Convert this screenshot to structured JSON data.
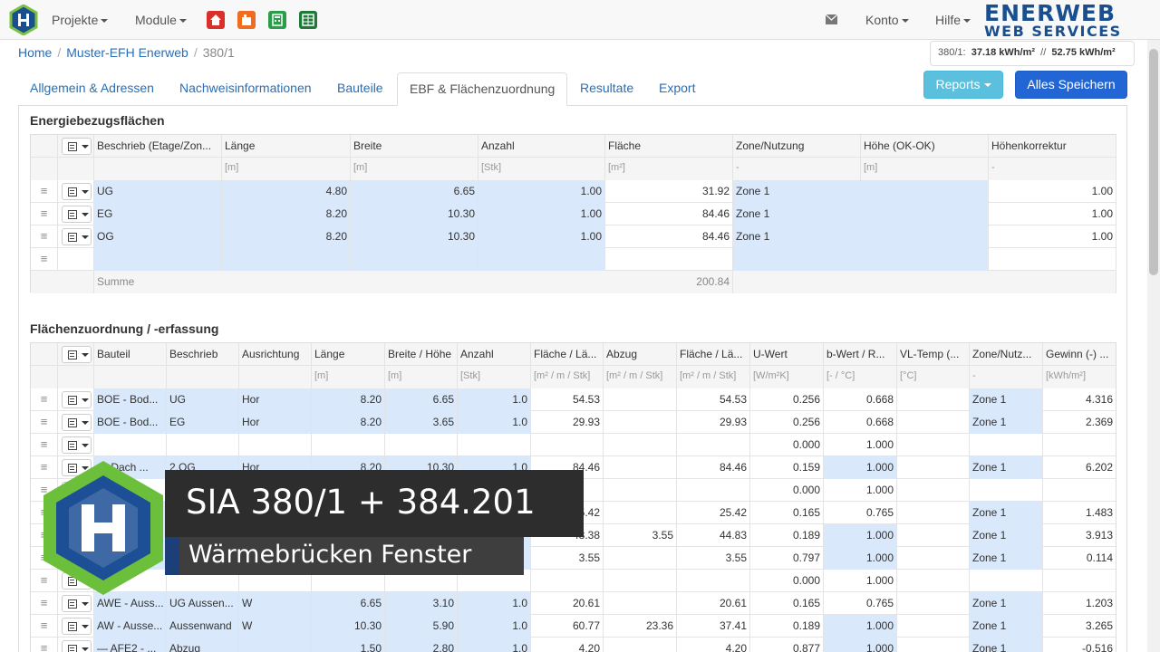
{
  "nav": {
    "projects": "Projekte",
    "modules": "Module",
    "account": "Konto",
    "help": "Hilfe"
  },
  "brand": {
    "line1": "ENERWEB",
    "line2": "WEB SERVICES"
  },
  "breadcrumb": {
    "home": "Home",
    "project": "Muster-EFH Enerweb",
    "current": "380/1"
  },
  "energy": {
    "label": "380/1:",
    "v1": "37.18 kWh/m²",
    "sep": "//",
    "v2": "52.75 kWh/m²"
  },
  "tabs": [
    "Allgemein & Adressen",
    "Nachweisinformationen",
    "Bauteile",
    "EBF & Flächenzuordnung",
    "Resultate",
    "Export"
  ],
  "buttons": {
    "reports": "Reports",
    "save": "Alles Speichern"
  },
  "ebf": {
    "title": "Energiebezugsflächen",
    "headers": [
      "Beschrieb (Etage/Zon...",
      "Länge",
      "Breite",
      "Anzahl",
      "Fläche",
      "Zone/Nutzung",
      "Höhe (OK-OK)",
      "Höhenkorrektur"
    ],
    "units": [
      "",
      "[m]",
      "[m]",
      "[Stk]",
      "[m²]",
      "-",
      "[m]",
      "-"
    ],
    "rows": [
      [
        "UG",
        "4.80",
        "6.65",
        "1.00",
        "31.92",
        "Zone 1",
        "",
        "1.00"
      ],
      [
        "EG",
        "8.20",
        "10.30",
        "1.00",
        "84.46",
        "Zone 1",
        "",
        "1.00"
      ],
      [
        "OG",
        "8.20",
        "10.30",
        "1.00",
        "84.46",
        "Zone 1",
        "",
        "1.00"
      ],
      [
        "",
        "",
        "",
        "",
        "",
        "",
        "",
        ""
      ]
    ],
    "sum_label": "Summe",
    "sum_value": "200.84"
  },
  "fz": {
    "title": "Flächenzuordnung / -erfassung",
    "headers": [
      "Bauteil",
      "Beschrieb",
      "Ausrichtung",
      "Länge",
      "Breite / Höhe",
      "Anzahl",
      "Fläche / Lä...",
      "Abzug",
      "Fläche / Lä...",
      "U-Wert",
      "b-Wert / R...",
      "VL-Temp (...",
      "Zone/Nutz...",
      "Gewinn (-) ..."
    ],
    "units": [
      "",
      "",
      "",
      "[m]",
      "[m]",
      "[Stk]",
      "[m² / m / Stk]",
      "[m² / m / Stk]",
      "[m² / m / Stk]",
      "[W/m²K]",
      "[- / °C]",
      "[°C]",
      "-",
      "[kWh/m²]"
    ],
    "rows": [
      [
        "BOE - Bod...",
        "UG",
        "Hor",
        "8.20",
        "6.65",
        "1.0",
        "54.53",
        "",
        "54.53",
        "0.256",
        "0.668",
        "",
        "Zone 1",
        "4.316"
      ],
      [
        "BOE - Bod...",
        "EG",
        "Hor",
        "8.20",
        "3.65",
        "1.0",
        "29.93",
        "",
        "29.93",
        "0.256",
        "0.668",
        "",
        "Zone 1",
        "2.369"
      ],
      [
        "",
        "",
        "",
        "",
        "",
        "",
        "",
        "",
        "",
        "0.000",
        "1.000",
        "",
        "",
        ""
      ],
      [
        "— Dach ...",
        "2.OG",
        "Hor",
        "8.20",
        "10.30",
        "1.0",
        "84.46",
        "",
        "84.46",
        "0.159",
        "1.000",
        "",
        "Zone 1",
        "6.202"
      ],
      [
        "",
        "",
        "",
        "",
        "",
        "",
        "",
        "",
        "",
        "0.000",
        "1.000",
        "",
        "",
        ""
      ],
      [
        "",
        "",
        "",
        "",
        "",
        "",
        "25.42",
        "",
        "25.42",
        "0.165",
        "0.765",
        "",
        "Zone 1",
        "1.483"
      ],
      [
        "",
        "",
        "",
        "",
        "",
        "",
        "48.38",
        "3.55",
        "44.83",
        "0.189",
        "1.000",
        "",
        "Zone 1",
        "3.913"
      ],
      [
        "",
        "",
        "",
        "",
        "",
        "",
        "3.55",
        "",
        "3.55",
        "0.797",
        "1.000",
        "",
        "Zone 1",
        "0.114"
      ],
      [
        "",
        "",
        "",
        "",
        "",
        "",
        "",
        "",
        "",
        "0.000",
        "1.000",
        "",
        "",
        ""
      ],
      [
        "AWE - Auss...",
        "UG Aussen...",
        "W",
        "6.65",
        "3.10",
        "1.0",
        "20.61",
        "",
        "20.61",
        "0.165",
        "0.765",
        "",
        "Zone 1",
        "1.203"
      ],
      [
        "AW - Ausse...",
        "Aussenwand",
        "W",
        "10.30",
        "5.90",
        "1.0",
        "60.77",
        "23.36",
        "37.41",
        "0.189",
        "1.000",
        "",
        "Zone 1",
        "3.265"
      ],
      [
        "— AFE2 - ...",
        "Abzug",
        "",
        "1.50",
        "2.80",
        "1.0",
        "4.20",
        "",
        "4.20",
        "0.877",
        "1.000",
        "",
        "Zone 1",
        "-0.516"
      ]
    ]
  },
  "overlay": {
    "title": "SIA 380/1 + 384.201",
    "subtitle": "Wärmebrücken Fenster"
  }
}
